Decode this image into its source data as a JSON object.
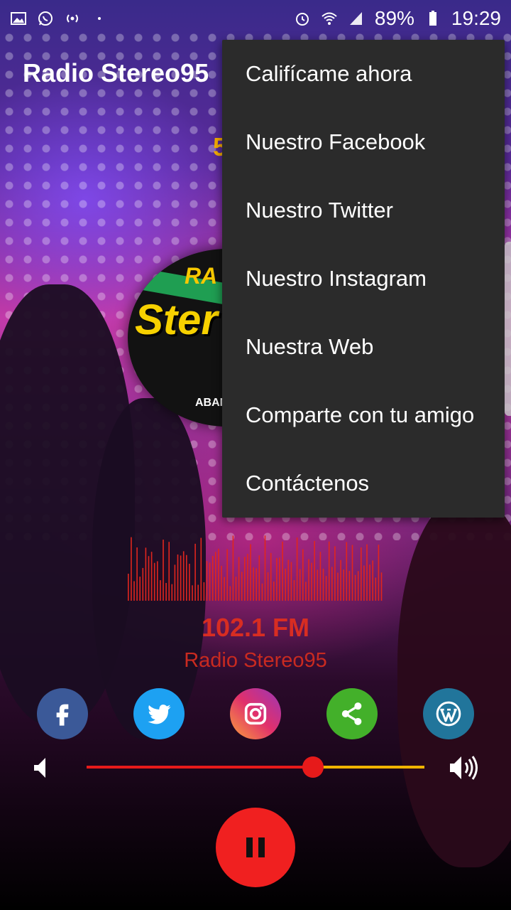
{
  "status_bar": {
    "battery_percent": "89%",
    "time": "19:29"
  },
  "app": {
    "title": "Radio Stereo95"
  },
  "logo": {
    "line1": "RA",
    "line2": "Ster",
    "line3": "ABAN"
  },
  "menu": {
    "items": [
      {
        "label": "Califícame ahora"
      },
      {
        "label": "Nuestro Facebook"
      },
      {
        "label": "Nuestro Twitter"
      },
      {
        "label": "Nuestro Instagram"
      },
      {
        "label": "Nuestra Web"
      },
      {
        "label": "Comparte con tu amigo"
      },
      {
        "label": "Contáctenos"
      }
    ]
  },
  "player": {
    "frequency": "102.1 FM",
    "station_name": "Radio Stereo95",
    "volume_fraction": 0.67,
    "state": "playing"
  },
  "social": [
    {
      "name": "facebook-icon",
      "color": "#3b5998"
    },
    {
      "name": "twitter-icon",
      "color": "#1da1f2"
    },
    {
      "name": "instagram-icon",
      "color": "#e1306c"
    },
    {
      "name": "share-icon",
      "color": "#43b02a"
    },
    {
      "name": "wordpress-icon",
      "color": "#21759b"
    }
  ],
  "colors": {
    "accent_red": "#e61a1a",
    "track_yellow": "#f0b400",
    "menu_bg": "#2b2b2b"
  }
}
